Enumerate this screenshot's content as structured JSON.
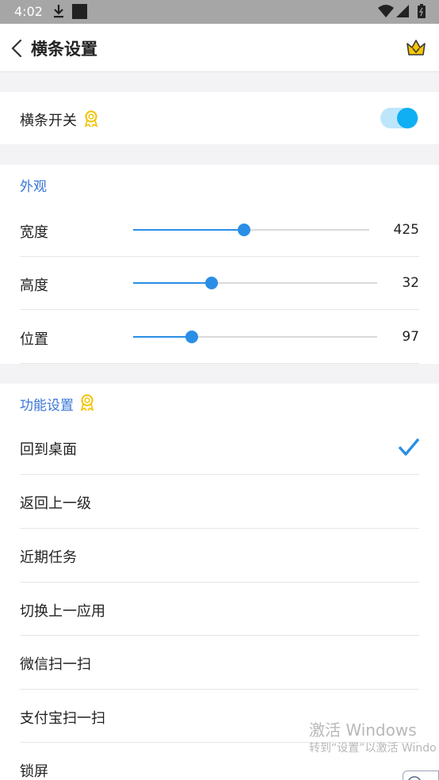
{
  "status_bar": {
    "time": "4:02",
    "icons": [
      "download-icon",
      "notification-square-icon",
      "wifi-icon",
      "signal-icon",
      "battery-icon"
    ]
  },
  "header": {
    "title": "横条设置",
    "back_icon": "chevron-left-icon",
    "vip_icon": "crown-icon"
  },
  "toggle_section": {
    "label": "横条开关",
    "enabled": true,
    "badge_icon": "vip-badge-icon",
    "accent_color": "#10aef3"
  },
  "appearance": {
    "section_title": "外观",
    "sliders": [
      {
        "label": "宽度",
        "value": "425",
        "fraction": 0.47
      },
      {
        "label": "高度",
        "value": "32",
        "fraction": 0.32
      },
      {
        "label": "位置",
        "value": "97",
        "fraction": 0.24
      }
    ]
  },
  "functions": {
    "section_title": "功能设置",
    "badge_icon": "vip-badge-icon",
    "items": [
      {
        "label": "回到桌面",
        "selected": true
      },
      {
        "label": "返回上一级",
        "selected": false
      },
      {
        "label": "近期任务",
        "selected": false
      },
      {
        "label": "切换上一应用",
        "selected": false
      },
      {
        "label": "微信扫一扫",
        "selected": false
      },
      {
        "label": "支付宝扫一扫",
        "selected": false
      },
      {
        "label": "锁屏",
        "selected": false
      }
    ]
  },
  "watermark": {
    "line1": "激活 Windows",
    "line2": "转到“设置”以激活 Windo"
  },
  "colors": {
    "section_title": "#3a76d6",
    "slider": "#2a8ee6",
    "check": "#2a8ee6",
    "badge": "#f2c200"
  }
}
